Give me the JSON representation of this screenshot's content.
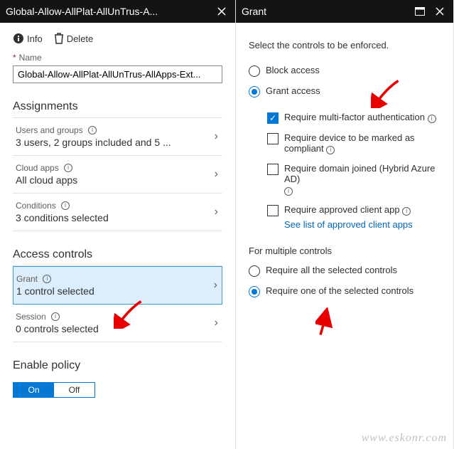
{
  "left": {
    "header_title": "Global-Allow-AllPlat-AllUnTrus-A...",
    "toolbar": {
      "info": "Info",
      "delete": "Delete"
    },
    "name_label": "Name",
    "name_value": "Global-Allow-AllPlat-AllUnTrus-AllApps-Ext...",
    "sections": {
      "assignments_title": "Assignments",
      "access_controls_title": "Access controls",
      "enable_policy_title": "Enable policy"
    },
    "rows": {
      "users_title": "Users and groups",
      "users_sub": "3 users, 2 groups included and 5 ...",
      "cloud_title": "Cloud apps",
      "cloud_sub": "All cloud apps",
      "cond_title": "Conditions",
      "cond_sub": "3 conditions selected",
      "grant_title": "Grant",
      "grant_sub": "1 control selected",
      "session_title": "Session",
      "session_sub": "0 controls selected"
    },
    "toggle": {
      "on": "On",
      "off": "Off"
    }
  },
  "right": {
    "header_title": "Grant",
    "subhead": "Select the controls to be enforced.",
    "radio_block": "Block access",
    "radio_grant": "Grant access",
    "controls": {
      "mfa": "Require multi-factor authentication",
      "compliant": "Require device to be marked as compliant",
      "domain": "Require domain joined (Hybrid Azure AD)",
      "approved": "Require approved client app",
      "approved_link": "See list of approved client apps"
    },
    "multi_label": "For multiple controls",
    "multi_all": "Require all the selected controls",
    "multi_one": "Require one of the selected controls"
  },
  "watermark": "www.eskonr.com"
}
